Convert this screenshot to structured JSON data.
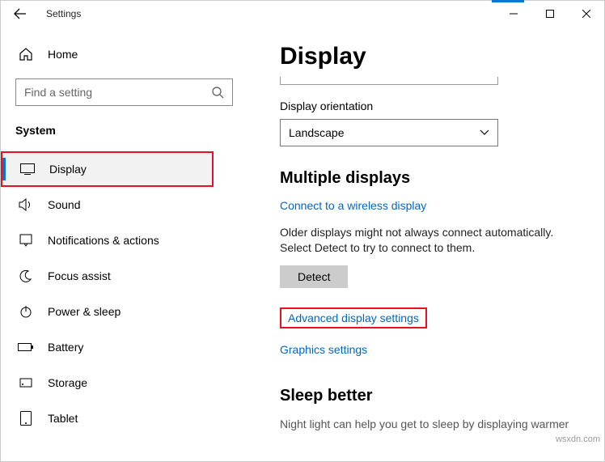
{
  "window": {
    "title": "Settings"
  },
  "sidebar": {
    "home": "Home",
    "search_placeholder": "Find a setting",
    "category": "System",
    "items": [
      {
        "label": "Display",
        "icon": "monitor-icon",
        "active": true
      },
      {
        "label": "Sound",
        "icon": "speaker-icon"
      },
      {
        "label": "Notifications & actions",
        "icon": "notification-icon"
      },
      {
        "label": "Focus assist",
        "icon": "moon-icon"
      },
      {
        "label": "Power & sleep",
        "icon": "power-icon"
      },
      {
        "label": "Battery",
        "icon": "battery-icon"
      },
      {
        "label": "Storage",
        "icon": "storage-icon"
      },
      {
        "label": "Tablet",
        "icon": "tablet-icon"
      }
    ]
  },
  "content": {
    "page_title": "Display",
    "orientation_label": "Display orientation",
    "orientation_value": "Landscape",
    "multiple_title": "Multiple displays",
    "wireless_link": "Connect to a wireless display",
    "detect_help": "Older displays might not always connect automatically. Select Detect to try to connect to them.",
    "detect_btn": "Detect",
    "advanced_link": "Advanced display settings",
    "graphics_link": "Graphics settings",
    "sleep_title": "Sleep better",
    "sleep_help": "Night light can help you get to sleep by displaying warmer"
  },
  "watermark": "wsxdn.com"
}
